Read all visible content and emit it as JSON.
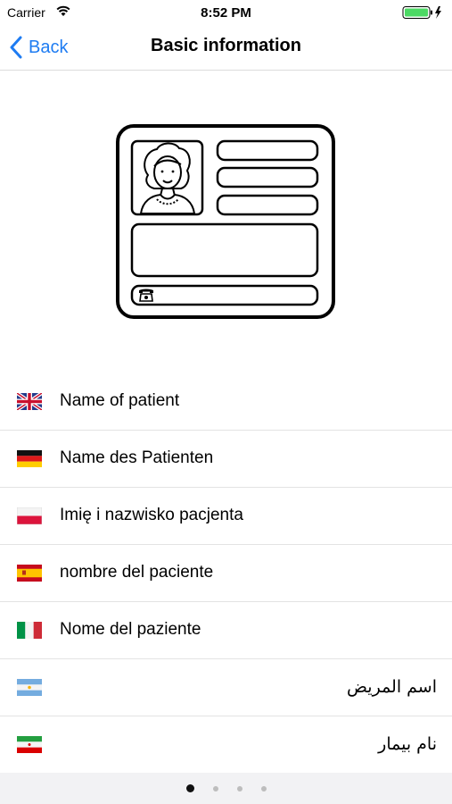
{
  "status_bar": {
    "carrier": "Carrier",
    "time": "8:52 PM"
  },
  "nav": {
    "back_label": "Back",
    "title": "Basic information"
  },
  "colors": {
    "accent": "#1e7cf2",
    "battery": "#4cd964"
  },
  "list": [
    {
      "flag": "uk-flag-icon",
      "label": "Name of patient"
    },
    {
      "flag": "germany-flag-icon",
      "label": "Name des Patienten"
    },
    {
      "flag": "poland-flag-icon",
      "label": "Imię i nazwisko pacjenta"
    },
    {
      "flag": "spain-flag-icon",
      "label": "nombre del paciente"
    },
    {
      "flag": "italy-flag-icon",
      "label": "Nome del paziente"
    },
    {
      "flag": "argentina-flag-icon",
      "label": "اسم المريض"
    },
    {
      "flag": "iran-flag-icon",
      "label": "نام بیمار"
    }
  ],
  "page_indicator": {
    "pages": 4,
    "current": 1
  }
}
